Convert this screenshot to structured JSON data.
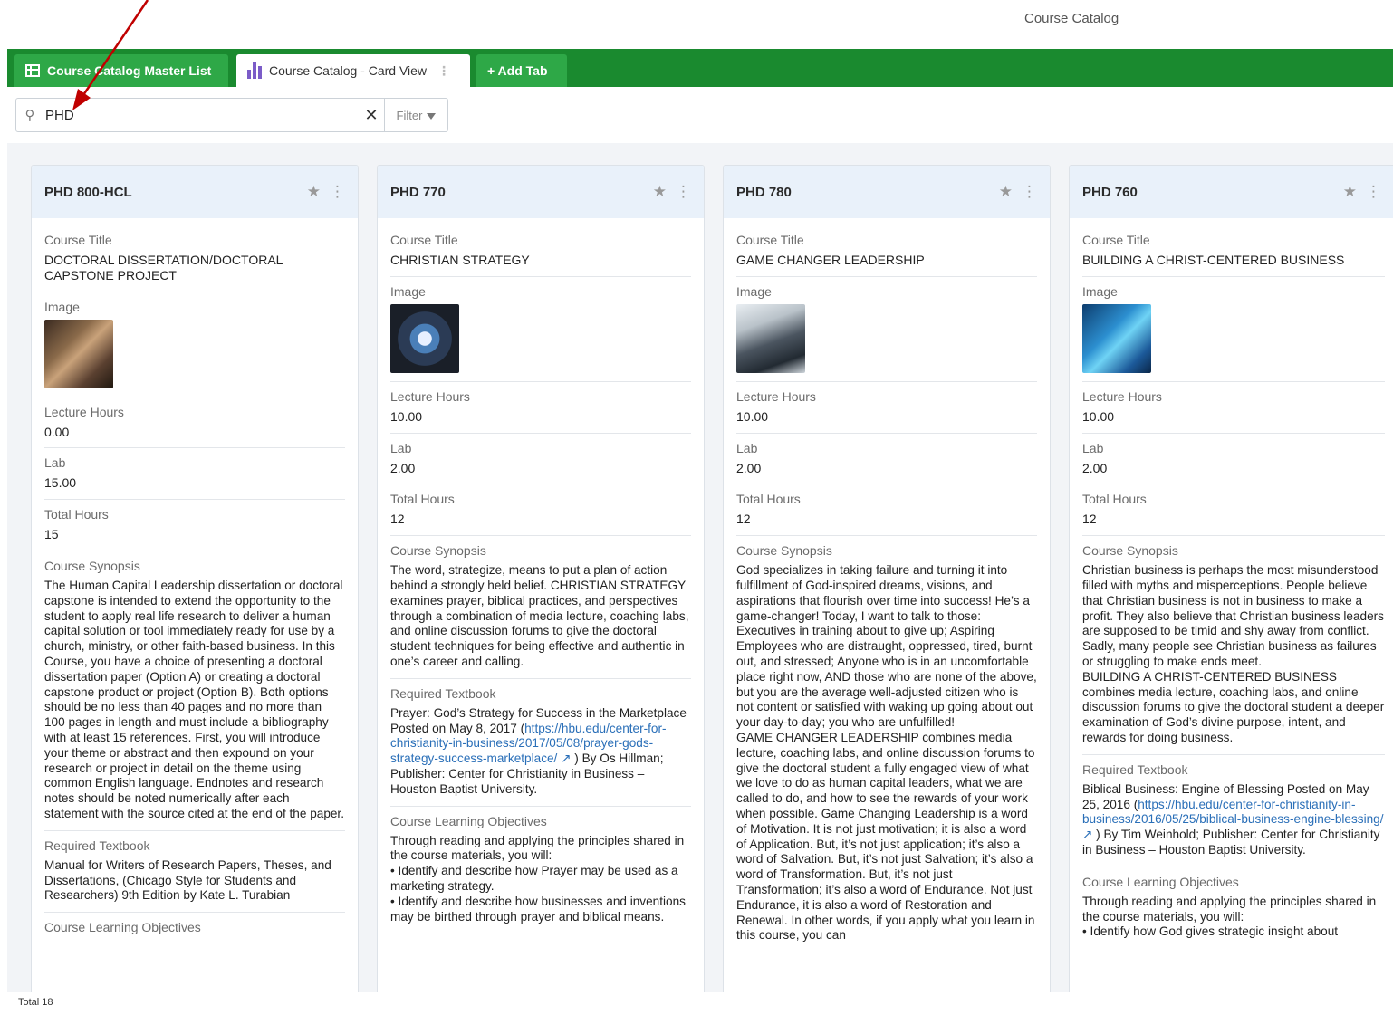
{
  "app": {
    "title": "Course Catalog"
  },
  "tabs": {
    "master_label": "Course Catalog Master List",
    "card_label": "Course Catalog - Card View",
    "add_label": "+ Add Tab"
  },
  "search": {
    "value": "PHD",
    "filter_label": "Filter"
  },
  "labels": {
    "course_title": "Course Title",
    "image": "Image",
    "lecture_hours": "Lecture Hours",
    "lab": "Lab",
    "total_hours": "Total Hours",
    "course_synopsis": "Course Synopsis",
    "required_textbook": "Required Textbook",
    "course_learning_objectives": "Course Learning Objectives"
  },
  "cards": [
    {
      "code": "PHD 800-HCL",
      "title": "DOCTORAL DISSERTATION/DOCTORAL CAPSTONE PROJECT",
      "lecture_hours": "0.00",
      "lab": "15.00",
      "total_hours": "15",
      "synopsis": "The Human Capital Leadership dissertation or doctoral capstone is intended to extend the opportunity to the student to apply real life research to deliver a human capital solution or tool immediately ready for use by a church, ministry, or other faith-based business. In this Course, you have a choice of presenting a doctoral dissertation paper (Option A) or creating a doctoral capstone product or project (Option B). Both options should be no less than 40 pages and no more than 100 pages in length and must include a bibliography with at least 15 references. First, you will introduce your theme or abstract and then expound on your research or project in detail on the theme using common English language. Endnotes and research notes should be noted numerically after each statement with the source cited at the end of the paper.",
      "textbook": "Manual for Writers of Research Papers, Theses, and Dissertations, (Chicago Style for Students and Researchers) 9th Edition by Kate L. Turabian",
      "objectives": ""
    },
    {
      "code": "PHD 770",
      "title": "CHRISTIAN STRATEGY",
      "lecture_hours": "10.00",
      "lab": "2.00",
      "total_hours": "12",
      "synopsis": "The word, strategize, means to put a plan of action behind a strongly held belief. CHRISTIAN STRATEGY examines prayer, biblical practices, and perspectives through a combination of media lecture, coaching labs, and online discussion forums to give the doctoral student techniques for being effective and authentic in one’s career and calling.",
      "textbook_pre": "Prayer: God’s Strategy for Success in the Marketplace Posted on May 8, 2017 (",
      "textbook_link": "https://hbu.edu/center-for-christianity-in-business/2017/05/08/prayer-gods-strategy-success-marketplace/",
      "textbook_post": ") By Os Hillman; Publisher: Center for Christianity in Business – Houston Baptist University.",
      "objectives": "Through reading and applying the principles shared in the course materials, you will:\n• Identify and describe how Prayer may be used as a marketing strategy.\n• Identify and describe how businesses and inventions may be birthed through prayer and biblical means."
    },
    {
      "code": "PHD 780",
      "title": "GAME CHANGER LEADERSHIP",
      "lecture_hours": "10.00",
      "lab": "2.00",
      "total_hours": "12",
      "synopsis": "God specializes in taking failure and turning it into fulfillment of God-inspired dreams, visions, and aspirations that flourish over time into success! He’s a game-changer! Today, I want to talk to those: Executives in training about to give up; Aspiring Employees who are distraught, oppressed, tired, burnt out, and stressed; Anyone who is in an uncomfortable place right now, AND those who are none of the above, but you are the average well-adjusted citizen who is not content or satisfied with waking up going about out your day-to-day; you who are unfulfilled!\nGAME CHANGER LEADERSHIP combines media lecture, coaching labs, and online discussion forums to give the doctoral student a fully engaged view of what we love to do as human capital leaders, what we are called to do, and how to see the rewards of your work when possible. Game Changing Leadership is a word of Motivation. It is not just motivation; it is also a word of Application. But, it’s not just application; it’s also a word of Salvation. But, it’s not just Salvation; it’s also a word of Transformation. But, it’s not just Transformation; it’s also a word of Endurance. Not just Endurance, it is also a word of Restoration and Renewal. In other words, if you apply what you learn in this course, you can"
    },
    {
      "code": "PHD 760",
      "title": "BUILDING A CHRIST-CENTERED BUSINESS",
      "lecture_hours": "10.00",
      "lab": "2.00",
      "total_hours": "12",
      "synopsis": "Christian business is perhaps the most misunderstood filled with myths and misperceptions. People believe that Christian business is not in business to make a profit. They also believe that Christian business leaders are supposed to be timid and shy away from conflict. Sadly, many people see Christian business as failures or struggling to make ends meet.\nBUILDING A CHRIST-CENTERED BUSINESS combines media lecture, coaching labs, and online discussion forums to give the doctoral student a deeper examination of God’s divine purpose, intent, and rewards for doing business.",
      "textbook_pre": "Biblical Business: Engine of Blessing Posted on May 25, 2016 (",
      "textbook_link": "https://hbu.edu/center-for-christianity-in-business/2016/05/25/biblical-business-engine-blessing/",
      "textbook_post": ") By Tim Weinhold; Publisher: Center for Christianity in Business – Houston Baptist University.",
      "objectives": "Through reading and applying the principles shared in the course materials, you will:\n• Identify how God gives strategic insight about"
    }
  ],
  "footer": {
    "total": "Total 18"
  },
  "colors": {
    "tab_bar": "#1a8a2f",
    "tab_active_green": "#2ea847",
    "annotation_arrow": "#c00000",
    "link": "#2a6fb8"
  }
}
